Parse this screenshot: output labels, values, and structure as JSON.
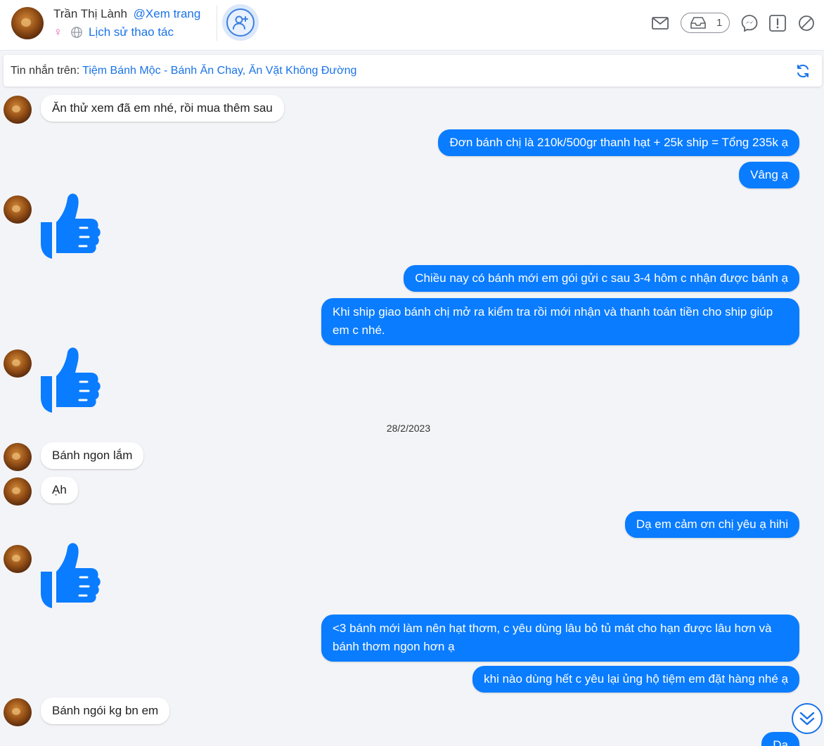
{
  "header": {
    "name": "Trần Thị Lành",
    "view_page": "@Xem trang",
    "gender_symbol": "♀",
    "history": "Lịch sử thao tác",
    "inbox_count": "1"
  },
  "source": {
    "label": "Tin nhắn trên:",
    "page": "Tiệm Bánh Mộc - Bánh Ăn Chay, Ăn Vặt Không Đường"
  },
  "messages": [
    {
      "dir": "in",
      "text": "Ăn thử xem đã em nhé, rồi mua thêm sau"
    },
    {
      "dir": "out",
      "text": "Đơn bánh chị là 210k/500gr thanh hạt + 25k ship = Tổng 235k ạ"
    },
    {
      "dir": "out",
      "text": "Vâng ạ"
    },
    {
      "dir": "in",
      "type": "like"
    },
    {
      "dir": "out",
      "text": "Chiều nay có bánh mới em gói gửi c sau 3-4 hôm c nhận được bánh ạ"
    },
    {
      "dir": "out",
      "text": "Khi ship giao bánh chị mở ra kiểm tra rồi mới nhận và thanh toán tiền cho ship giúp em c nhé."
    },
    {
      "dir": "in",
      "type": "like"
    },
    {
      "type": "date",
      "text": "28/2/2023"
    },
    {
      "dir": "in",
      "text": "Bánh ngon lắm"
    },
    {
      "dir": "in",
      "text": "Ạh"
    },
    {
      "dir": "out",
      "text": "Dạ em cảm ơn chị yêu ạ hihi"
    },
    {
      "dir": "in",
      "type": "like"
    },
    {
      "dir": "out",
      "text": "<3 bánh mới làm nên hạt thơm, c yêu dùng lâu bỏ tủ mát cho hạn được lâu hơn và bánh thơm ngon hơn ạ"
    },
    {
      "dir": "out",
      "text": "khi nào dùng hết c yêu lại ủng hộ tiệm em đặt hàng nhé ạ"
    },
    {
      "dir": "in",
      "text": "Bánh ngói kg bn em"
    },
    {
      "dir": "out",
      "text": "Dạ"
    }
  ],
  "colors": {
    "accent": "#1a73e8",
    "outgoing_bubble": "#0a7cff",
    "background": "#f3f4f7"
  }
}
